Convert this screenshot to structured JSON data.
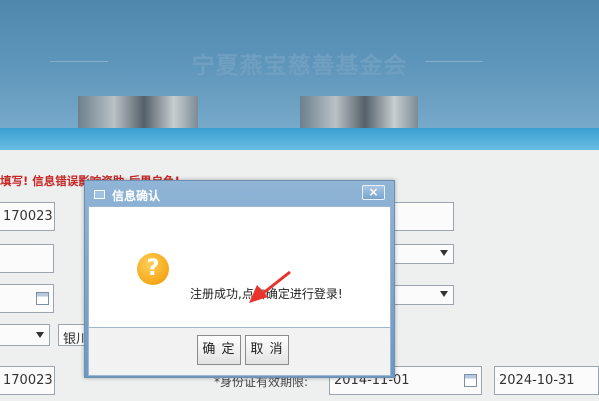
{
  "banner": {
    "title": "宁夏燕宝慈善基金会"
  },
  "form": {
    "warning": "填写! 信息错误影响资助,后果自负!",
    "id_partial_1": "170023",
    "id_partial_2": "170023",
    "city_select": "银川",
    "id_valid_label": "*身份证有效期限:",
    "valid_from": "2014-11-01",
    "valid_to": "2024-10-31"
  },
  "dialog": {
    "title": "信息确认",
    "close": "×",
    "icon": "?",
    "message": "注册成功,点击确定进行登录!",
    "ok_label": "确 定",
    "cancel_label": "取 消"
  },
  "colors": {
    "warning": "#c62828",
    "dialog_frame": "#7aa4cb",
    "icon": "#f4a818",
    "annotation_arrow": "#e8322b"
  }
}
